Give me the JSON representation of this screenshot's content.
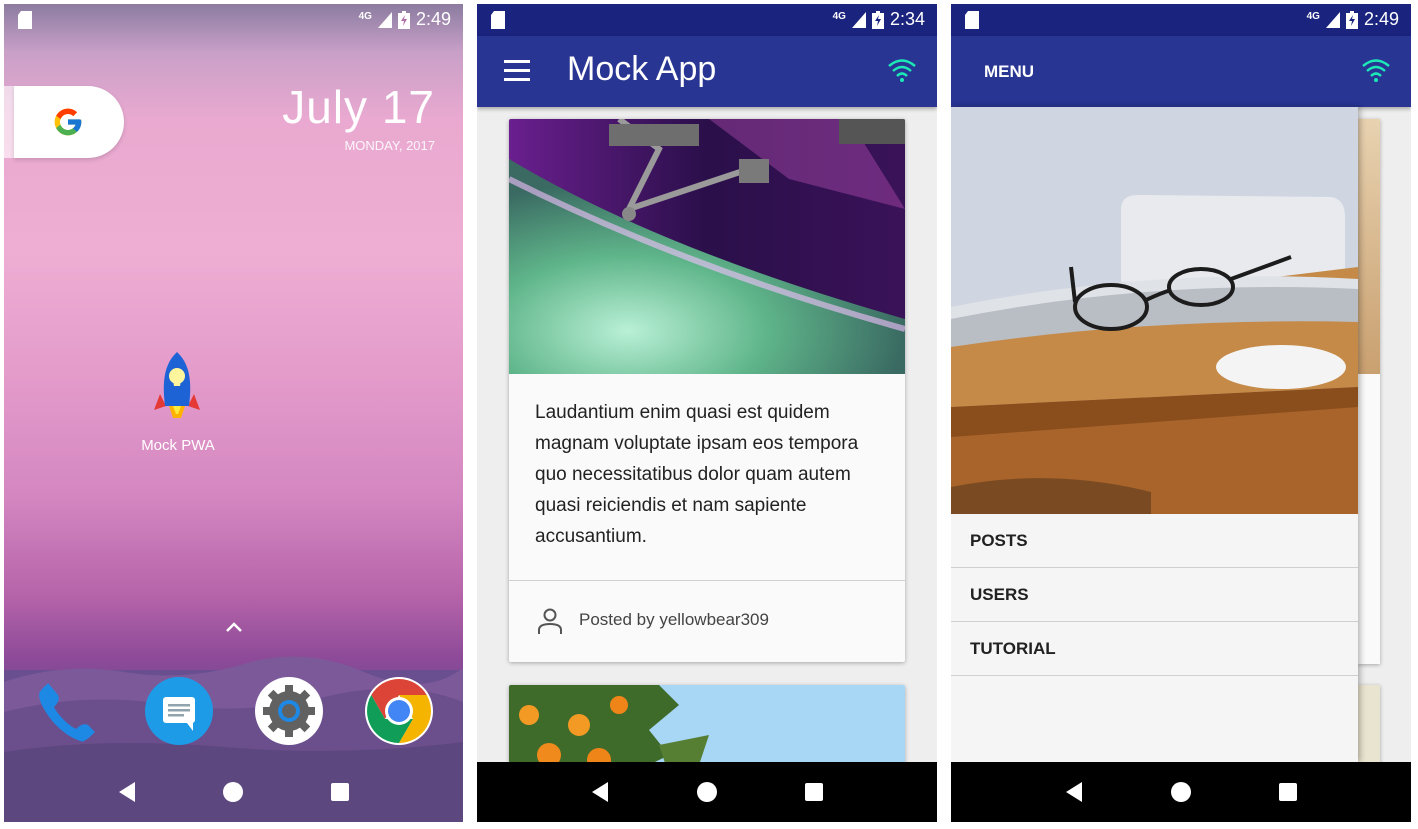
{
  "home": {
    "status": {
      "network": "4G",
      "time": "2:49"
    },
    "date": "July 17",
    "day": "MONDAY, 2017",
    "app_label": "Mock PWA",
    "search_icon": "google-g-icon",
    "dock": [
      "phone-icon",
      "messages-icon",
      "settings-icon",
      "chrome-icon"
    ]
  },
  "app": {
    "status": {
      "network": "4G",
      "time": "2:34"
    },
    "title": "Mock App",
    "card_text": "Laudantium enim quasi est quidem magnam voluptate ipsam eos tempora quo necessitatibus dolor quam autem quasi reiciendis et nam sapiente accusantium.",
    "posted_by": "Posted by yellowbear309",
    "icons": [
      "menu-icon",
      "wifi-icon",
      "person-icon"
    ]
  },
  "drawer": {
    "status": {
      "network": "4G",
      "time": "2:49"
    },
    "menu_label": "MENU",
    "items": [
      "POSTS",
      "USERS",
      "TUTORIAL"
    ]
  },
  "colors": {
    "appbar": "#283593",
    "wifi": "#1de9b6",
    "nav_black": "#000000"
  }
}
